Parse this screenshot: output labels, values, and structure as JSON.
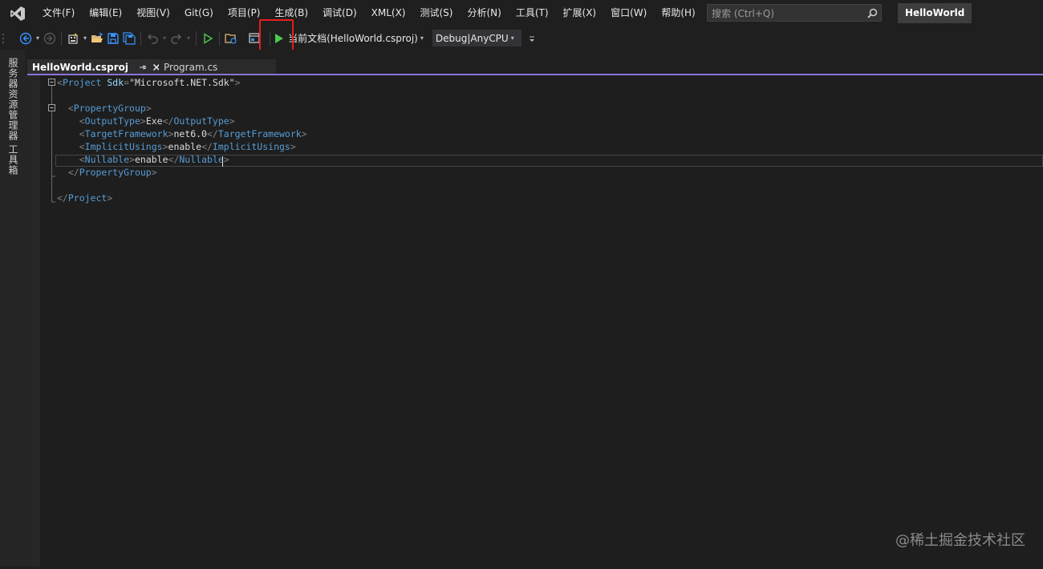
{
  "menu": {
    "items": [
      "文件(F)",
      "编辑(E)",
      "视图(V)",
      "Git(G)",
      "项目(P)",
      "生成(B)",
      "调试(D)",
      "XML(X)",
      "测试(S)",
      "分析(N)",
      "工具(T)",
      "扩展(X)",
      "窗口(W)",
      "帮助(H)"
    ]
  },
  "search": {
    "placeholder": "搜索 (Ctrl+Q)"
  },
  "solution_name": "HelloWorld",
  "toolbar": {
    "start_label": "当前文档(HelloWorld.csproj)",
    "configuration": "Debug|AnyCPU"
  },
  "side_rail": {
    "tabs": [
      "服务器资源管理器",
      "工具箱"
    ]
  },
  "tabs": [
    {
      "label": "HelloWorld.csproj",
      "active": true
    },
    {
      "label": "Program.cs",
      "active": false
    }
  ],
  "code": {
    "project_open_tag": "Project",
    "sdk_attr": "Sdk",
    "sdk_value": "\"Microsoft.NET.Sdk\"",
    "property_group": "PropertyGroup",
    "output_type_tag": "OutputType",
    "output_type_value": "Exe",
    "target_framework_tag": "TargetFramework",
    "target_framework_value": "net6.0",
    "implicit_usings_tag": "ImplicitUsings",
    "implicit_usings_value": "enable",
    "nullable_tag": "Nullable",
    "nullable_value": "enable"
  },
  "watermark": "@稀土掘金技术社区",
  "colors": {
    "accent": "#8b72d6",
    "highlight_box": "#e81d1d",
    "xml_tag": "#569cd6",
    "start_green": "#4ec94e"
  }
}
